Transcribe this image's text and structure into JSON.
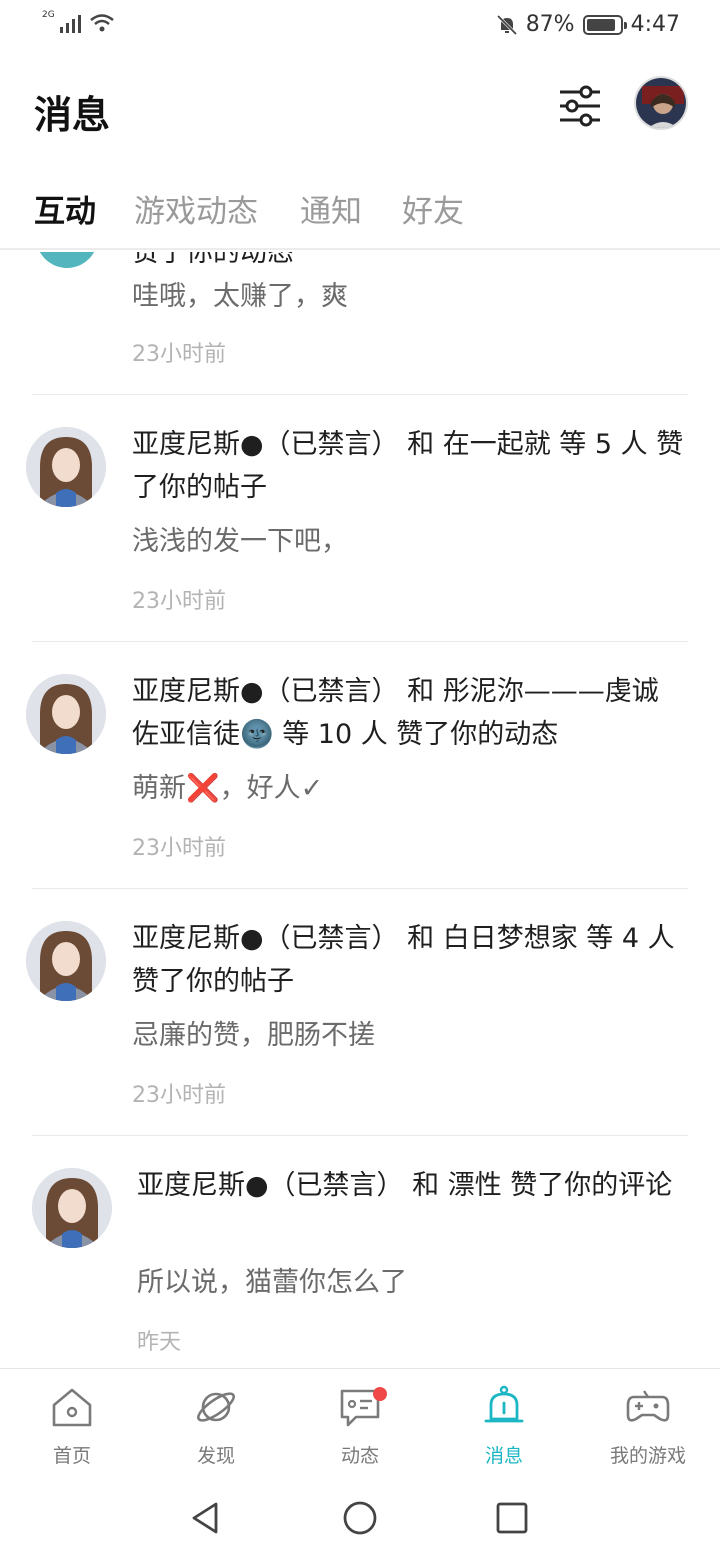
{
  "status_bar": {
    "network": "2G",
    "battery": "87%",
    "battery_level": 0.87,
    "time": "4:47",
    "icons": [
      "signal-icon",
      "wifi-icon",
      "mute-bell-icon",
      "battery-icon"
    ]
  },
  "header": {
    "title": "消息",
    "icons": [
      "filter-icon",
      "avatar"
    ]
  },
  "tabs": [
    {
      "label": "互动",
      "active": true
    },
    {
      "label": "游戏动态",
      "active": false
    },
    {
      "label": "通知",
      "active": false
    },
    {
      "label": "好友",
      "active": false
    }
  ],
  "partial_item": {
    "title_fragment": "赞了你的动态",
    "content": "哇哦，太赚了，爽",
    "time": "23小时前"
  },
  "items": [
    {
      "title": "亚度尼斯●（已禁言） 和 在一起就 等 5 人 赞了你的帖子",
      "content": "浅浅的发一下吧，",
      "time": "23小时前"
    },
    {
      "title": "亚度尼斯●（已禁言） 和 彤泥沵———虔诚佐亚信徒🌚 等 10 人 赞了你的动态",
      "content": "萌新❌，好人✓",
      "time": "23小时前"
    },
    {
      "title": "亚度尼斯●（已禁言） 和 白日梦想家 等 4 人 赞了你的帖子",
      "content": "忌廉的赞，肥肠不搓",
      "time": "23小时前"
    },
    {
      "title": "亚度尼斯●（已禁言） 和 漂性 赞了你的评论",
      "content": "所以说，猫蕾你怎么了",
      "time": "昨天"
    }
  ],
  "bottom_nav": [
    {
      "label": "首页",
      "icon": "home-icon",
      "active": false
    },
    {
      "label": "发现",
      "icon": "planet-icon",
      "active": false
    },
    {
      "label": "动态",
      "icon": "chat-icon",
      "active": false,
      "badge": true
    },
    {
      "label": "消息",
      "icon": "bell-icon",
      "active": true
    },
    {
      "label": "我的游戏",
      "icon": "gamepad-icon",
      "active": false
    }
  ],
  "system_nav": [
    "back-icon",
    "home-circle-icon",
    "recents-icon"
  ],
  "colors": {
    "accent": "#1cb6c4",
    "badge": "#f04848",
    "text_primary": "#1f1f1f",
    "text_secondary": "#6b6b6b",
    "text_muted": "#b3b3b3"
  }
}
